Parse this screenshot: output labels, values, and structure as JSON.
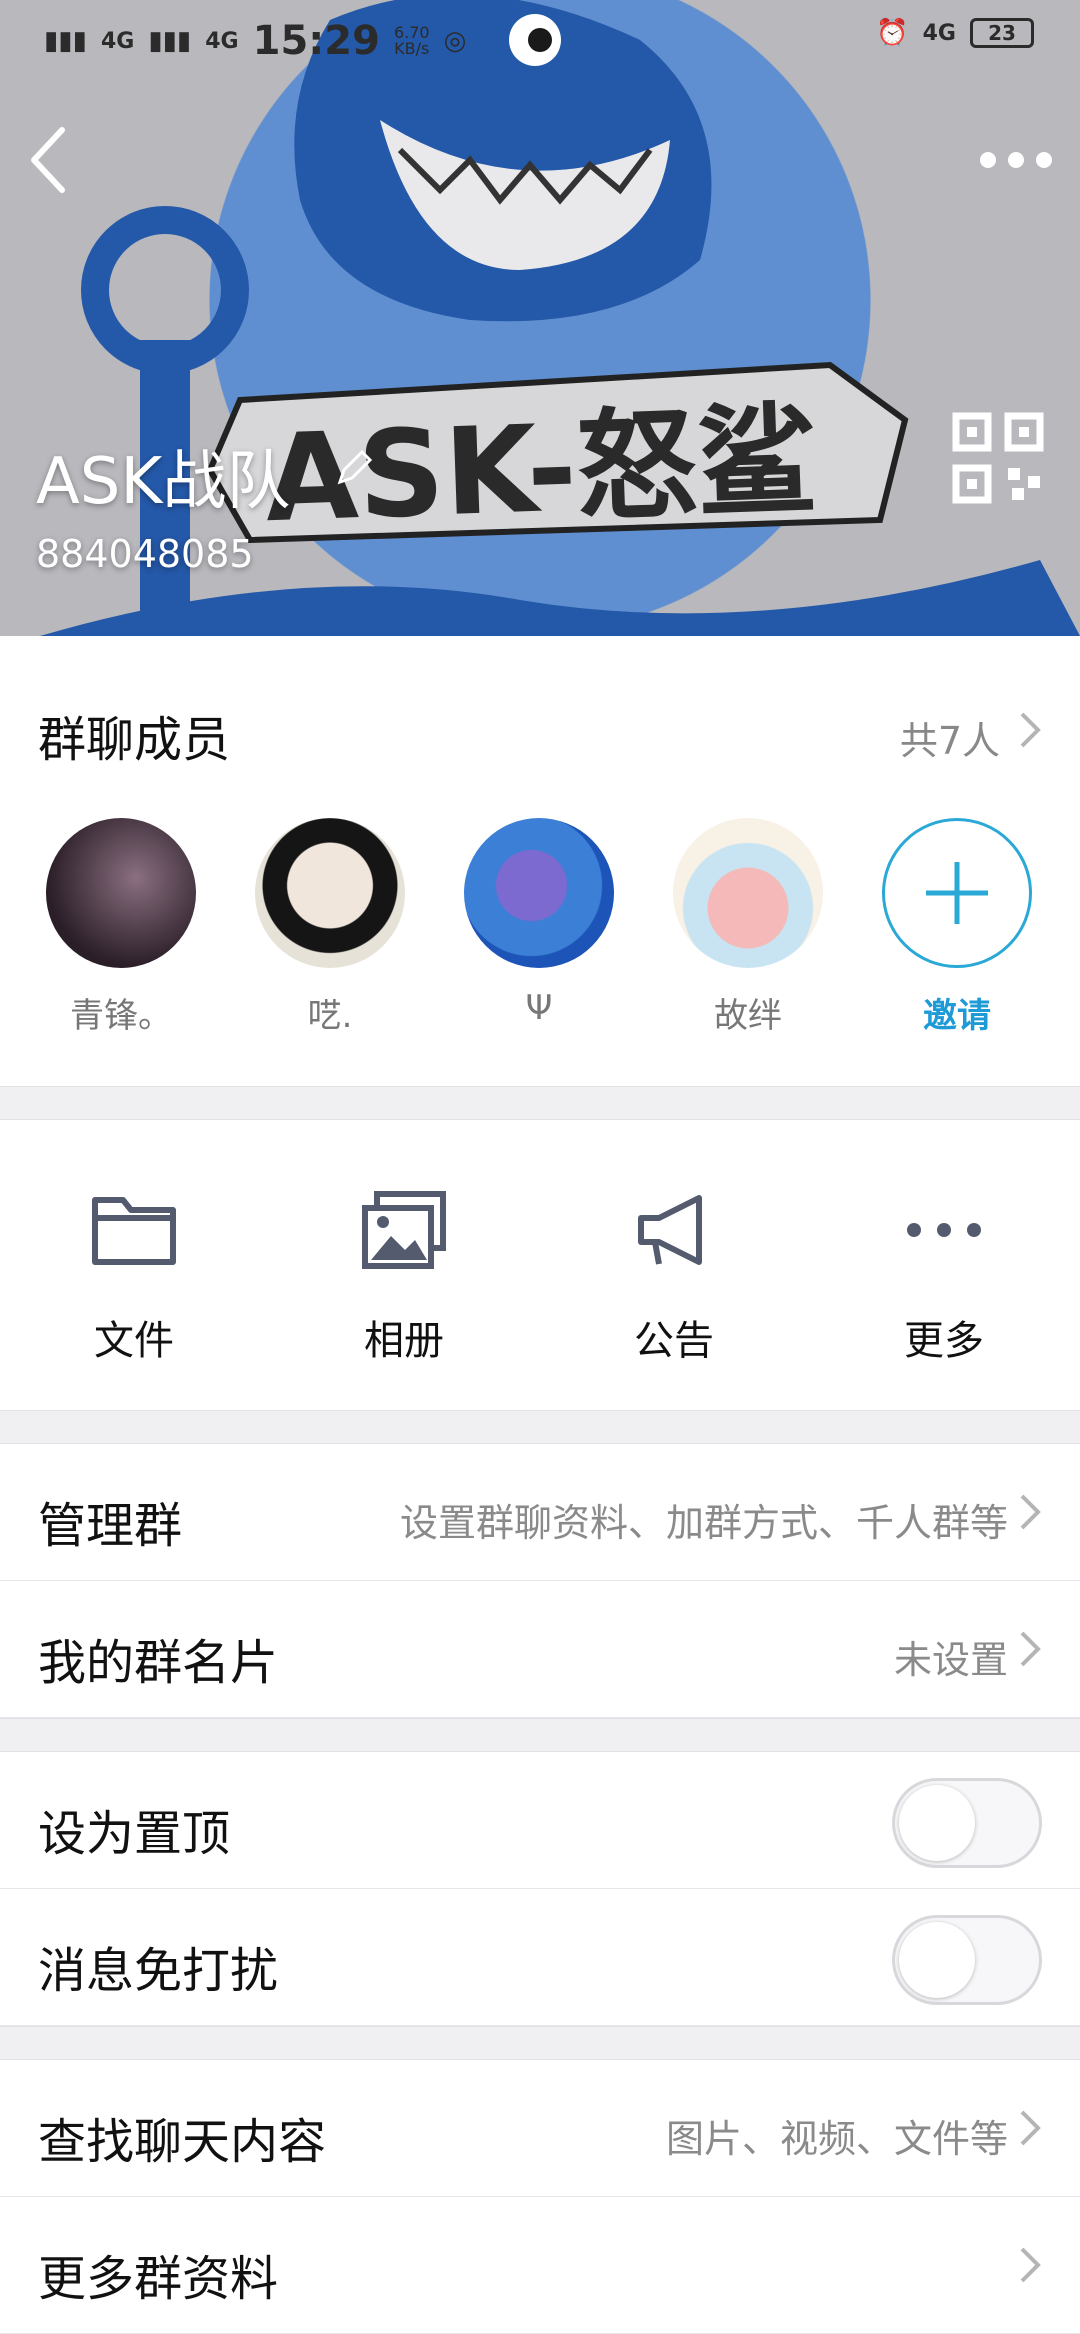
{
  "status_bar": {
    "net1": "4G",
    "net2": "4G",
    "time": "15:29",
    "speed_value": "6.70",
    "speed_unit": "KB/s",
    "net3": "4G",
    "battery": "23"
  },
  "header": {
    "banner_text": "ASK-怒鲨",
    "group_name": "ASK战队",
    "group_id": "884048085"
  },
  "members": {
    "title": "群聊成员",
    "count": "共7人",
    "items": [
      {
        "name": "青锋。"
      },
      {
        "name": "呓."
      },
      {
        "name": "Ψ"
      },
      {
        "name": "故绊"
      }
    ],
    "invite_label": "邀请"
  },
  "tools": [
    {
      "label": "文件",
      "icon": "folder-icon"
    },
    {
      "label": "相册",
      "icon": "album-icon"
    },
    {
      "label": "公告",
      "icon": "megaphone-icon"
    },
    {
      "label": "更多",
      "icon": "more-icon"
    }
  ],
  "settings": {
    "manage": {
      "title": "管理群",
      "value": "设置群聊资料、加群方式、千人群等"
    },
    "card": {
      "title": "我的群名片",
      "value": "未设置"
    },
    "pin": {
      "title": "设为置顶"
    },
    "mute": {
      "title": "消息免打扰"
    },
    "search": {
      "title": "查找聊天内容",
      "value": "图片、视频、文件等"
    },
    "more_info": {
      "title": "更多群资料"
    }
  },
  "colors": {
    "accent": "#1e9bd7",
    "shark_blue": "#2458a8"
  }
}
